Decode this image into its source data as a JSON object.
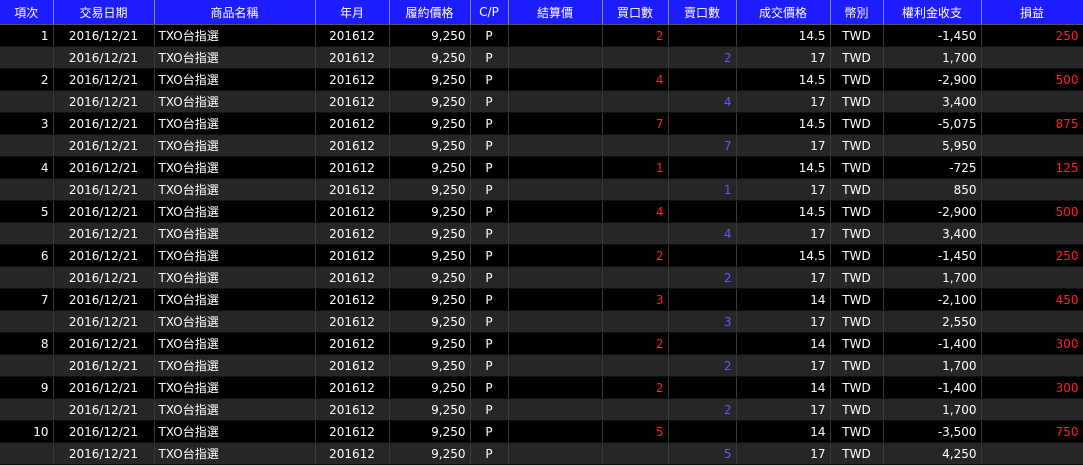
{
  "columns": [
    "項次",
    "交易日期",
    "商品名稱",
    "年月",
    "履約價格",
    "C/P",
    "結算價",
    "買口數",
    "賣口數",
    "成交價格",
    "幣別",
    "權利金收支",
    "損益"
  ],
  "rows": [
    {
      "item": "1",
      "date": "2016/12/21",
      "product": "TXO台指選",
      "month": "201612",
      "strike": "9,250",
      "cp": "P",
      "settle": "",
      "buy": "2",
      "sell": "",
      "price": "14.5",
      "currency": "TWD",
      "premium": "-1,450",
      "pnl": "250"
    },
    {
      "item": "",
      "date": "2016/12/21",
      "product": "TXO台指選",
      "month": "201612",
      "strike": "9,250",
      "cp": "P",
      "settle": "",
      "buy": "",
      "sell": "2",
      "price": "17",
      "currency": "TWD",
      "premium": "1,700",
      "pnl": ""
    },
    {
      "item": "2",
      "date": "2016/12/21",
      "product": "TXO台指選",
      "month": "201612",
      "strike": "9,250",
      "cp": "P",
      "settle": "",
      "buy": "4",
      "sell": "",
      "price": "14.5",
      "currency": "TWD",
      "premium": "-2,900",
      "pnl": "500"
    },
    {
      "item": "",
      "date": "2016/12/21",
      "product": "TXO台指選",
      "month": "201612",
      "strike": "9,250",
      "cp": "P",
      "settle": "",
      "buy": "",
      "sell": "4",
      "price": "17",
      "currency": "TWD",
      "premium": "3,400",
      "pnl": ""
    },
    {
      "item": "3",
      "date": "2016/12/21",
      "product": "TXO台指選",
      "month": "201612",
      "strike": "9,250",
      "cp": "P",
      "settle": "",
      "buy": "7",
      "sell": "",
      "price": "14.5",
      "currency": "TWD",
      "premium": "-5,075",
      "pnl": "875"
    },
    {
      "item": "",
      "date": "2016/12/21",
      "product": "TXO台指選",
      "month": "201612",
      "strike": "9,250",
      "cp": "P",
      "settle": "",
      "buy": "",
      "sell": "7",
      "price": "17",
      "currency": "TWD",
      "premium": "5,950",
      "pnl": ""
    },
    {
      "item": "4",
      "date": "2016/12/21",
      "product": "TXO台指選",
      "month": "201612",
      "strike": "9,250",
      "cp": "P",
      "settle": "",
      "buy": "1",
      "sell": "",
      "price": "14.5",
      "currency": "TWD",
      "premium": "-725",
      "pnl": "125"
    },
    {
      "item": "",
      "date": "2016/12/21",
      "product": "TXO台指選",
      "month": "201612",
      "strike": "9,250",
      "cp": "P",
      "settle": "",
      "buy": "",
      "sell": "1",
      "price": "17",
      "currency": "TWD",
      "premium": "850",
      "pnl": ""
    },
    {
      "item": "5",
      "date": "2016/12/21",
      "product": "TXO台指選",
      "month": "201612",
      "strike": "9,250",
      "cp": "P",
      "settle": "",
      "buy": "4",
      "sell": "",
      "price": "14.5",
      "currency": "TWD",
      "premium": "-2,900",
      "pnl": "500"
    },
    {
      "item": "",
      "date": "2016/12/21",
      "product": "TXO台指選",
      "month": "201612",
      "strike": "9,250",
      "cp": "P",
      "settle": "",
      "buy": "",
      "sell": "4",
      "price": "17",
      "currency": "TWD",
      "premium": "3,400",
      "pnl": ""
    },
    {
      "item": "6",
      "date": "2016/12/21",
      "product": "TXO台指選",
      "month": "201612",
      "strike": "9,250",
      "cp": "P",
      "settle": "",
      "buy": "2",
      "sell": "",
      "price": "14.5",
      "currency": "TWD",
      "premium": "-1,450",
      "pnl": "250"
    },
    {
      "item": "",
      "date": "2016/12/21",
      "product": "TXO台指選",
      "month": "201612",
      "strike": "9,250",
      "cp": "P",
      "settle": "",
      "buy": "",
      "sell": "2",
      "price": "17",
      "currency": "TWD",
      "premium": "1,700",
      "pnl": ""
    },
    {
      "item": "7",
      "date": "2016/12/21",
      "product": "TXO台指選",
      "month": "201612",
      "strike": "9,250",
      "cp": "P",
      "settle": "",
      "buy": "3",
      "sell": "",
      "price": "14",
      "currency": "TWD",
      "premium": "-2,100",
      "pnl": "450"
    },
    {
      "item": "",
      "date": "2016/12/21",
      "product": "TXO台指選",
      "month": "201612",
      "strike": "9,250",
      "cp": "P",
      "settle": "",
      "buy": "",
      "sell": "3",
      "price": "17",
      "currency": "TWD",
      "premium": "2,550",
      "pnl": ""
    },
    {
      "item": "8",
      "date": "2016/12/21",
      "product": "TXO台指選",
      "month": "201612",
      "strike": "9,250",
      "cp": "P",
      "settle": "",
      "buy": "2",
      "sell": "",
      "price": "14",
      "currency": "TWD",
      "premium": "-1,400",
      "pnl": "300"
    },
    {
      "item": "",
      "date": "2016/12/21",
      "product": "TXO台指選",
      "month": "201612",
      "strike": "9,250",
      "cp": "P",
      "settle": "",
      "buy": "",
      "sell": "2",
      "price": "17",
      "currency": "TWD",
      "premium": "1,700",
      "pnl": ""
    },
    {
      "item": "9",
      "date": "2016/12/21",
      "product": "TXO台指選",
      "month": "201612",
      "strike": "9,250",
      "cp": "P",
      "settle": "",
      "buy": "2",
      "sell": "",
      "price": "14",
      "currency": "TWD",
      "premium": "-1,400",
      "pnl": "300"
    },
    {
      "item": "",
      "date": "2016/12/21",
      "product": "TXO台指選",
      "month": "201612",
      "strike": "9,250",
      "cp": "P",
      "settle": "",
      "buy": "",
      "sell": "2",
      "price": "17",
      "currency": "TWD",
      "premium": "1,700",
      "pnl": ""
    },
    {
      "item": "10",
      "date": "2016/12/21",
      "product": "TXO台指選",
      "month": "201612",
      "strike": "9,250",
      "cp": "P",
      "settle": "",
      "buy": "5",
      "sell": "",
      "price": "14",
      "currency": "TWD",
      "premium": "-3,500",
      "pnl": "750"
    },
    {
      "item": "",
      "date": "2016/12/21",
      "product": "TXO台指選",
      "month": "201612",
      "strike": "9,250",
      "cp": "P",
      "settle": "",
      "buy": "",
      "sell": "5",
      "price": "17",
      "currency": "TWD",
      "premium": "4,250",
      "pnl": ""
    }
  ],
  "colors": {
    "header_bg": "#1c1cff",
    "buy_qty": "#ff2020",
    "sell_qty": "#5a5aff",
    "pnl": "#ff2020",
    "row_dark": "#000000",
    "row_gray": "#262626"
  }
}
